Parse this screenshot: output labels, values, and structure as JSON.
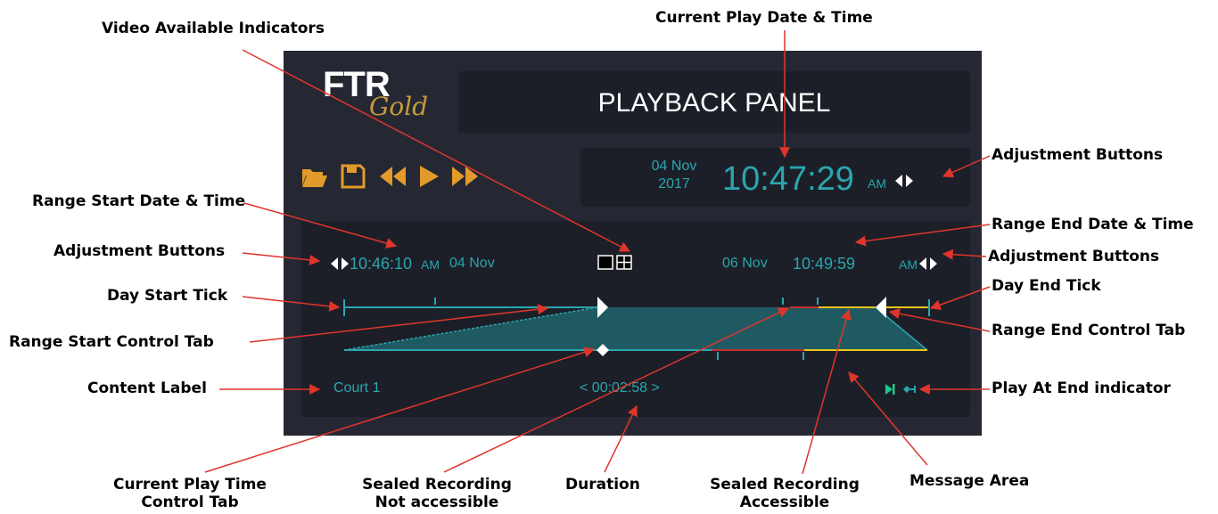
{
  "panel": {
    "logo_main": "FTR",
    "logo_sub": "Gold",
    "title": "PLAYBACK PANEL",
    "current_play": {
      "date_line1": "04 Nov",
      "date_line2": "2017",
      "time": "10:47:29",
      "ampm": "AM"
    },
    "range_start": {
      "time": "10:46:10",
      "ampm": "AM",
      "date": "04 Nov"
    },
    "range_end": {
      "date": "06 Nov",
      "time": "10:49:59",
      "ampm": "AM"
    },
    "content_label": "Court 1",
    "duration": "< 00:02:58 >",
    "icons": {
      "open": "folder-icon",
      "save": "save-icon",
      "rewind": "rewind-icon",
      "play": "play-icon",
      "fast_forward": "fast-forward-icon",
      "adjust": "left-right-arrows-icon",
      "video_available": "video-available-icon",
      "play_at_end": "play-at-end-icon"
    },
    "colors": {
      "panel_bg": "#252833",
      "section_bg": "#1c1f28",
      "accent_teal": "#2aa6ad",
      "control_orange": "#e29a2a",
      "sealed_red": "#c8302e",
      "sealed_accessible_yellow": "#e8c51c",
      "waveform_fill": "#1f5a62",
      "text_light": "#ffffff"
    }
  },
  "callouts": {
    "video_available": "Video Available Indicators",
    "current_play_datetime": "Current Play Date & Time",
    "adjustment_top": "Adjustment Buttons",
    "range_start_datetime": "Range Start Date & Time",
    "range_end_datetime": "Range End Date & Time",
    "adjustment_left": "Adjustment Buttons",
    "adjustment_right": "Adjustment Buttons",
    "day_start_tick": "Day Start Tick",
    "day_end_tick": "Day End Tick",
    "range_start_tab": "Range Start Control Tab",
    "range_end_tab": "Range End Control Tab",
    "content_label": "Content Label",
    "play_at_end": "Play At End indicator",
    "current_play_tab_l1": "Current Play Time",
    "current_play_tab_l2": "Control Tab",
    "sealed_not_l1": "Sealed Recording",
    "sealed_not_l2": "Not accessible",
    "duration": "Duration",
    "sealed_acc_l1": "Sealed Recording",
    "sealed_acc_l2": "Accessible",
    "message_area": "Message Area"
  }
}
